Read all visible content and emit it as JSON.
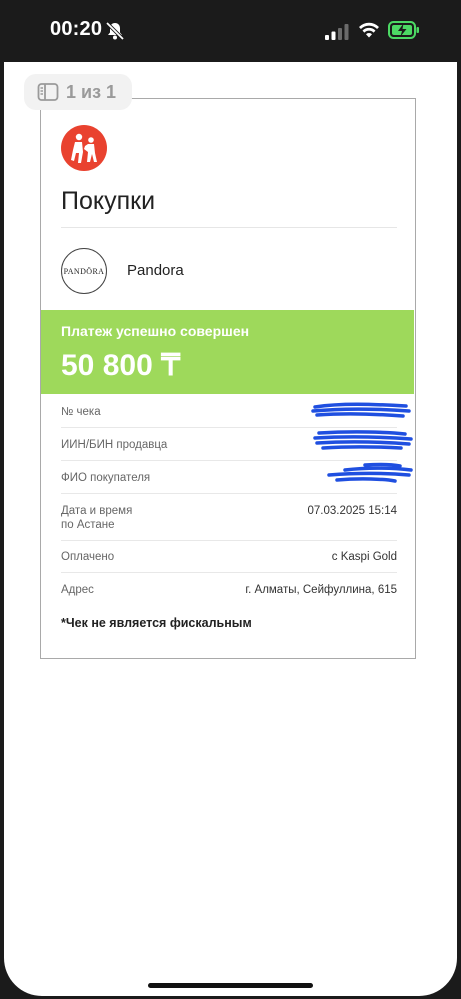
{
  "status_bar": {
    "time": "00:20",
    "icons": [
      "bell-slash-icon",
      "cellular-signal-icon",
      "wifi-icon",
      "battery-charging-icon"
    ],
    "battery_color": "#4cd964"
  },
  "viewer": {
    "page_indicator": "1 из 1",
    "page_indicator_icon": "sidebar-pages-icon"
  },
  "receipt": {
    "logo_icon": "kaspi-red-logo-icon",
    "title": "Покупки",
    "merchant": {
      "logo_text": "PANDÖRA",
      "name": "Pandora"
    },
    "status": "Платеж успешно совершен",
    "amount": "50 800 ₸",
    "accent_color": "#9ed95b",
    "details": [
      {
        "label": "№ чека",
        "value": ""
      },
      {
        "label": "ИИН/БИН продавца",
        "value": ""
      },
      {
        "label": "ФИО покупателя",
        "value": ""
      },
      {
        "label_line1": "Дата и время",
        "label_line2": "по Астане",
        "value": "07.03.2025 15:14"
      },
      {
        "label": "Оплачено",
        "value": "с Kaspi Gold"
      },
      {
        "label": "Адрес",
        "value": "г. Алматы, Сейфуллина, 615"
      }
    ],
    "note": "*Чек не является фискальным"
  }
}
